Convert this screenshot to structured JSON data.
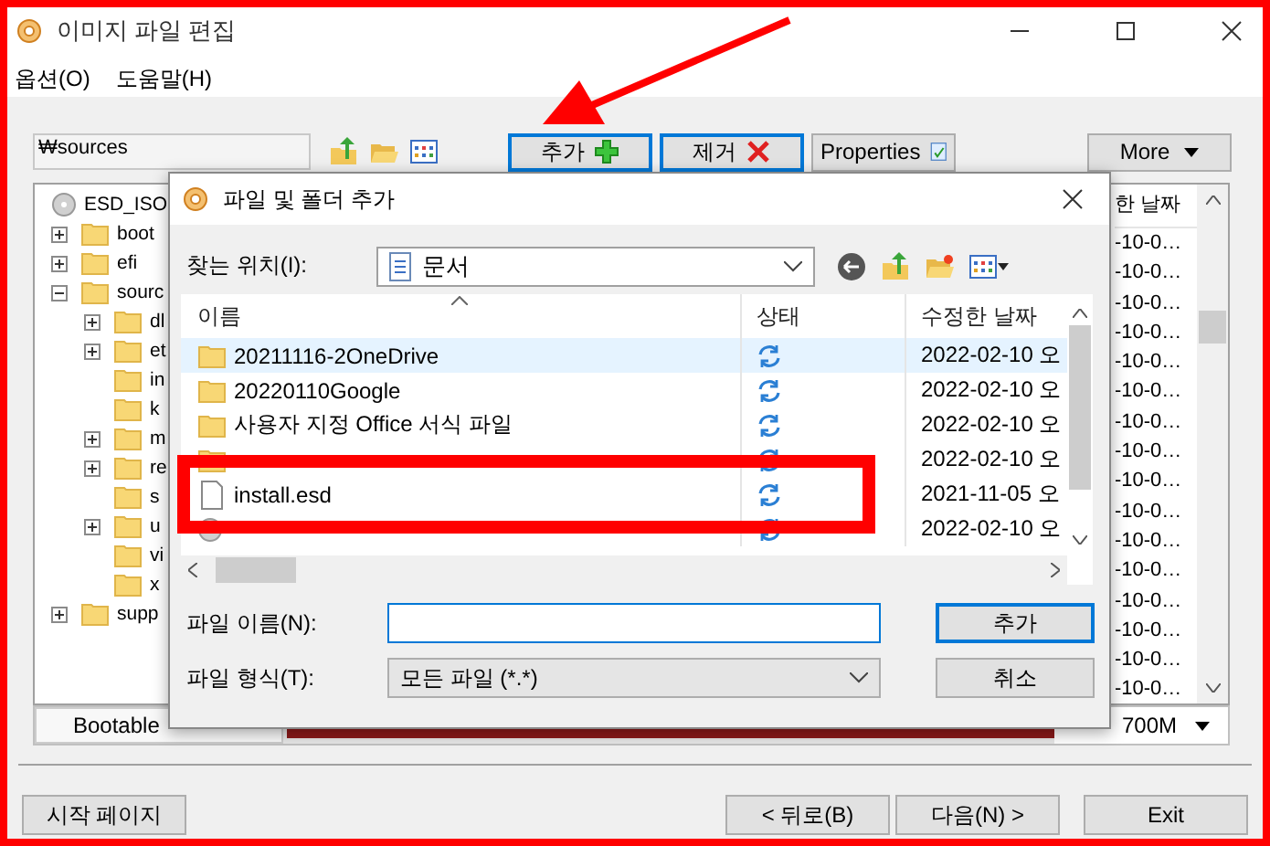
{
  "window": {
    "title": "이미지 파일 편집"
  },
  "menu": [
    {
      "label": "옵션(O)"
    },
    {
      "label": "도움말(H)"
    }
  ],
  "toolbar": {
    "path": "₩sources",
    "buttons": [
      {
        "label": "추가",
        "kind": "add"
      },
      {
        "label": "제거",
        "kind": "remove"
      },
      {
        "label": "Properties",
        "kind": "properties"
      }
    ],
    "more": "More"
  },
  "tree": {
    "root": "ESD_ISO",
    "items": [
      {
        "label": "boot",
        "kind": "branch",
        "expanded": false
      },
      {
        "label": "efi",
        "kind": "branch",
        "expanded": false
      },
      {
        "label": "sourc",
        "kind": "branch",
        "expanded": true,
        "children": [
          {
            "label": "dl",
            "kind": "branch",
            "expanded": false
          },
          {
            "label": "et",
            "kind": "branch",
            "expanded": false
          },
          {
            "label": "in",
            "kind": "leaf"
          },
          {
            "label": "k",
            "kind": "leaf"
          },
          {
            "label": "m",
            "kind": "branch",
            "expanded": false
          },
          {
            "label": "re",
            "kind": "branch",
            "expanded": false
          },
          {
            "label": "s",
            "kind": "leaf"
          },
          {
            "label": "u",
            "kind": "branch",
            "expanded": false
          },
          {
            "label": "vi",
            "kind": "leaf"
          },
          {
            "label": "x",
            "kind": "leaf"
          }
        ]
      },
      {
        "label": "supp",
        "kind": "branch",
        "expanded": false
      }
    ]
  },
  "file_list": {
    "header": "한 날짜",
    "rows": [
      "-10-0…",
      "-10-0…",
      "-10-0…",
      "-10-0…",
      "-10-0…",
      "-10-0…",
      "-10-0…",
      "-10-0…",
      "-10-0…",
      "-10-0…",
      "-10-0…",
      "-10-0…",
      "-10-0…",
      "-10-0…",
      "-10-0…",
      "-10-0…"
    ]
  },
  "bootable": {
    "label": "Bootable",
    "size": "700M"
  },
  "footer": {
    "start": "시작 페이지",
    "nav": [
      "< 뒤로(B)",
      "다음(N) >",
      "Exit"
    ]
  },
  "dialog": {
    "title": "파일 및 폴더 추가",
    "look_in_label": "찾는 위치(I):",
    "look_in": "문서",
    "columns": [
      "이름",
      "상태",
      "수정한 날짜"
    ],
    "rows": [
      {
        "name": "20211116-2OneDrive",
        "kind": "folder",
        "date": "2022-02-10 오",
        "highlighted": true
      },
      {
        "name": "20220110Google",
        "kind": "folder",
        "date": "2022-02-10 오",
        "highlighted": false
      },
      {
        "name": "사용자 지정 Office 서식 파일",
        "kind": "folder",
        "date": "2022-02-10 오",
        "highlighted": false
      },
      {
        "kind": "folder",
        "date": "2022-02-10 오",
        "highlighted": false
      },
      {
        "name": "install.esd",
        "kind": "file",
        "date": "2021-11-05 오",
        "highlighted": false
      },
      {
        "kind": "disc",
        "date": "2022-02-10 오",
        "highlighted": false
      }
    ],
    "file_name_label": "파일 이름(N):",
    "file_type_label": "파일 형식(T):",
    "file_type": "모든 파일 (*.*)",
    "buttons": [
      "추가",
      "취소"
    ]
  }
}
